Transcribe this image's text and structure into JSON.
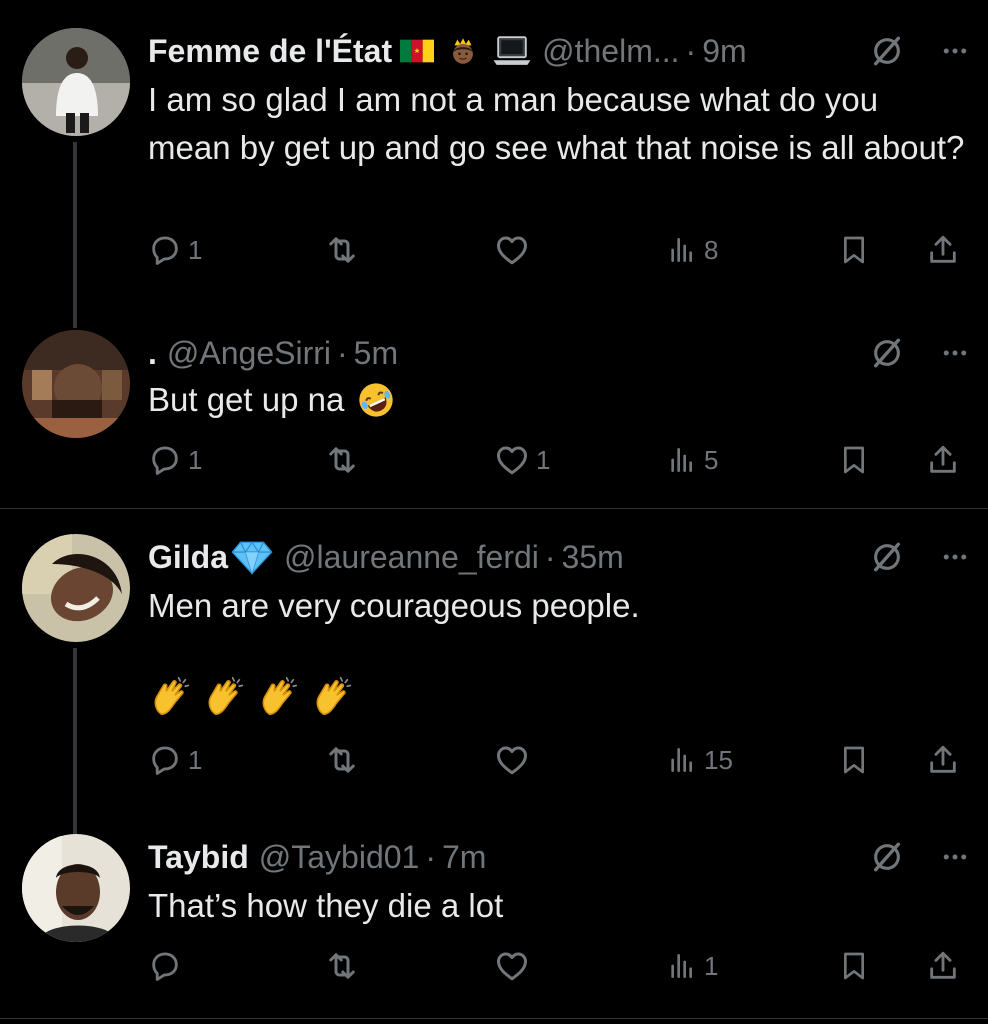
{
  "tweets": [
    {
      "name": "Femme de l'État",
      "name_emojis": [
        "flag-cameroon",
        "princess-crown",
        "laptop"
      ],
      "handle": "@thelm...",
      "dot": "·",
      "time": "9m",
      "text": "I am so glad I am not a man because what do you mean by get up and go see what that noise is all about?",
      "replies": "1",
      "retweets": "",
      "likes": "",
      "views": "8"
    },
    {
      "name": ".",
      "handle": "@AngeSirri",
      "dot": "·",
      "time": "5m",
      "text": "But get up na",
      "text_emoji": "rolling-laughing-face",
      "replies": "1",
      "retweets": "",
      "likes": "1",
      "views": "5"
    },
    {
      "name": "Gilda",
      "name_emojis": [
        "gem"
      ],
      "handle": "@laureanne_ferdi",
      "dot": "·",
      "time": "35m",
      "text": "Men are very courageous people.",
      "extra_emojis": [
        "clapping-hands",
        "clapping-hands",
        "clapping-hands",
        "clapping-hands"
      ],
      "replies": "1",
      "retweets": "",
      "likes": "",
      "views": "15"
    },
    {
      "name": "Taybid",
      "handle": "@Taybid01",
      "dot": "·",
      "time": "7m",
      "text": "That’s how they die a lot",
      "replies": "",
      "retweets": "",
      "likes": "",
      "views": "1"
    }
  ],
  "colors": {
    "background": "#000000",
    "text": "#e7e9ea",
    "muted": "#71767b",
    "divider": "#2f3336"
  },
  "icons": [
    "reply-icon",
    "retweet-icon",
    "like-icon",
    "views-icon",
    "bookmark-icon",
    "share-icon",
    "grok-icon",
    "more-icon"
  ]
}
